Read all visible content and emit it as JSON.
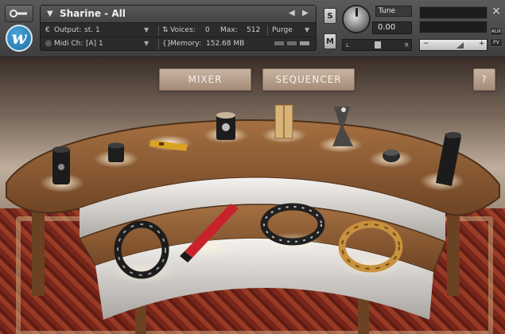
{
  "header": {
    "instrument_name": "Sharine - All",
    "nav_prev": "◀",
    "nav_next": "▶",
    "output_label": "Output:",
    "output_value": "st. 1",
    "voices_label": "Voices:",
    "voices_value": "0",
    "max_label": "Max:",
    "max_value": "512",
    "purge_label": "Purge",
    "midi_label": "Midi Ch:",
    "midi_value": "[A]  1",
    "memory_label": "Memory:",
    "memory_value": "152.68 MB",
    "solo_label": "S",
    "mute_label": "M",
    "tune_label": "Tune",
    "tune_value": "0.00",
    "pan_left": "L",
    "pan_right": "R",
    "vol_minus": "−",
    "vol_plus": "+",
    "aux_label": "AUX",
    "pv_label": "PV",
    "close_glyph": "×",
    "logo_letter": "w"
  },
  "stage": {
    "mixer_label": "MIXER",
    "sequencer_label": "SEQUENCER",
    "help_label": "?"
  },
  "instruments": [
    {
      "name": "shaker-tall-black"
    },
    {
      "name": "shaker-small-black"
    },
    {
      "name": "shaker-yellow-stick"
    },
    {
      "name": "shaker-drum"
    },
    {
      "name": "shaker-wooden-block"
    },
    {
      "name": "shaker-hourglass"
    },
    {
      "name": "shaker-small-dark"
    },
    {
      "name": "shaker-tall-black-right"
    },
    {
      "name": "tambourine-black"
    },
    {
      "name": "shaker-red-stick"
    },
    {
      "name": "tambourine-jingle-ring"
    },
    {
      "name": "tambourine-wooden"
    }
  ],
  "colors": {
    "accent_blue": "#2a86c2",
    "button_tan": "#b9a08b",
    "wood": "#8a5a34"
  }
}
